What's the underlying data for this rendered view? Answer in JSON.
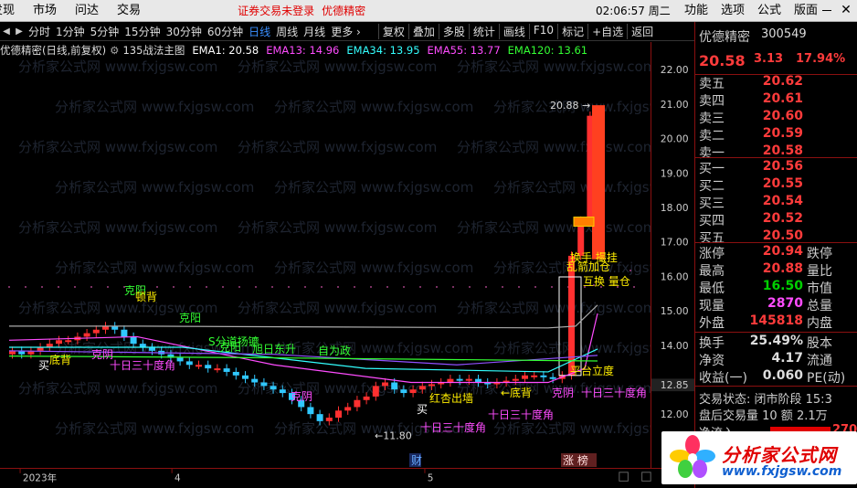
{
  "menubar": {
    "items": [
      "发现",
      "市场",
      "问达",
      "交易"
    ],
    "login_notice": "证券交易未登录",
    "stock_name": "优德精密",
    "clock": "02:06:57 周二",
    "right_items": [
      "功能",
      "选项",
      "公式",
      "版面"
    ],
    "close_glyph": "✕"
  },
  "toolbar": {
    "periods": [
      "分时",
      "1分钟",
      "5分钟",
      "15分钟",
      "30分钟",
      "60分钟",
      "日线",
      "周线",
      "月线",
      "更多 ›"
    ],
    "active_period": "日线",
    "tools": [
      "复权",
      "叠加",
      "多股",
      "统计",
      "画线",
      "F10",
      "标记",
      "+自选",
      "返回"
    ]
  },
  "infoline": {
    "stock": "优德精密(日线,前复权)",
    "formula": "135战法主图",
    "ema": [
      {
        "label": "EMA1: 20.58",
        "color": "#ffffff"
      },
      {
        "label": "EMA13: 14.96",
        "color": "#ff4cff"
      },
      {
        "label": "EMA34: 13.95",
        "color": "#33ffff"
      },
      {
        "label": "EMA55: 13.77",
        "color": "#ff4cff"
      },
      {
        "label": "EMA120: 13.61",
        "color": "#33ff33"
      }
    ]
  },
  "axis": {
    "prices": [
      "22.00",
      "21.00",
      "20.00",
      "19.00",
      "18.00",
      "17.00",
      "16.00",
      "15.00",
      "14.00",
      "12.85",
      "12.00"
    ],
    "current_price_tag": "12.85",
    "months": [
      "2023年",
      "4",
      "5"
    ]
  },
  "chart_annotations": {
    "high_label": "20.88",
    "low_label": "11.80",
    "signals_green": [
      "克阳",
      "克阳",
      "S分道扬镳",
      "旭日东升",
      "自为政",
      "克阳"
    ],
    "signals_magenta": [
      "十日三十度角",
      "克阴",
      "克阴",
      "十日三十度角",
      "克阴",
      "十日三十度角",
      "十日三十度角"
    ],
    "signals_white": [
      "买",
      "买"
    ],
    "signals_yellow": [
      "顿背",
      "底背",
      "红杏出墙",
      "←底背",
      "平台立度",
      "换手 撮挂",
      "乱箭加仓",
      "互换 量仓"
    ],
    "bottom_tags": [
      "财",
      "涨 榜"
    ],
    "watermark": "分析家公式网 www.fxjgsw.com"
  },
  "quote": {
    "name": "优德精密",
    "code": "300549",
    "price": "20.58",
    "change": "3.13",
    "pct": "17.94%",
    "asks": [
      {
        "label": "卖五",
        "price": "20.62"
      },
      {
        "label": "卖四",
        "price": "20.61"
      },
      {
        "label": "卖三",
        "price": "20.60"
      },
      {
        "label": "卖二",
        "price": "20.59"
      },
      {
        "label": "卖一",
        "price": "20.58"
      }
    ],
    "bids": [
      {
        "label": "买一",
        "price": "20.56"
      },
      {
        "label": "买二",
        "price": "20.55"
      },
      {
        "label": "买三",
        "price": "20.54"
      },
      {
        "label": "买四",
        "price": "20.52"
      },
      {
        "label": "买五",
        "price": "20.50"
      }
    ],
    "stats": [
      {
        "label": "涨停",
        "value": "20.94",
        "color": "red",
        "label2": "跌停"
      },
      {
        "label": "最高",
        "value": "20.88",
        "color": "red",
        "label2": "量比"
      },
      {
        "label": "最低",
        "value": "16.50",
        "color": "green",
        "label2": "市值"
      },
      {
        "label": "现量",
        "value": "2870",
        "color": "magenta",
        "label2": "总量"
      },
      {
        "label": "外盘",
        "value": "145818",
        "color": "red",
        "label2": "内盘"
      }
    ],
    "stats2": [
      {
        "label": "换手",
        "value": "25.49%",
        "color": "white",
        "label2": "股本"
      },
      {
        "label": "净资",
        "value": "4.17",
        "color": "white",
        "label2": "流通"
      },
      {
        "label": "收益(一)",
        "value": "0.060",
        "color": "white",
        "label2": "PE(动)"
      }
    ],
    "trade_status": "交易状态: 闭市阶段 15:3",
    "after_hours": "盘后交易量 10 额 2.1万",
    "net_inflow_label": "净流入",
    "net_inflow_value": "270"
  },
  "logo": {
    "text": "分析家公式网",
    "url": "www.fxjgsw.com"
  }
}
